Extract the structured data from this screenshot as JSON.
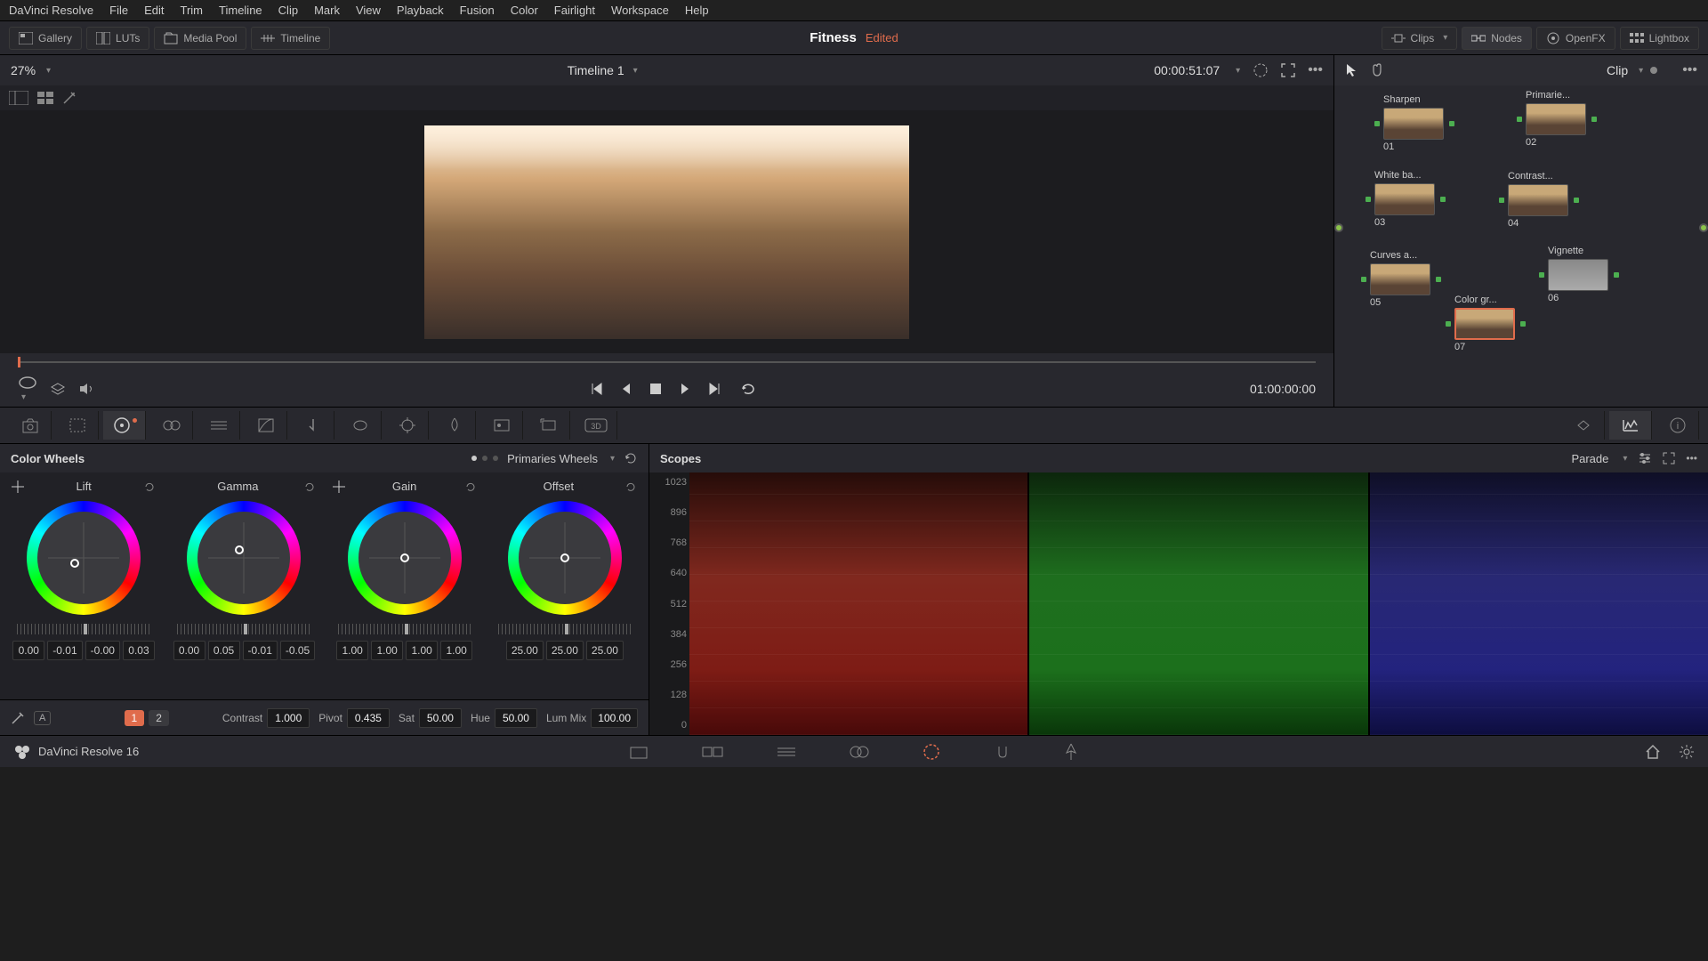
{
  "menu": [
    "DaVinci Resolve",
    "File",
    "Edit",
    "Trim",
    "Timeline",
    "Clip",
    "Mark",
    "View",
    "Playback",
    "Fusion",
    "Color",
    "Fairlight",
    "Workspace",
    "Help"
  ],
  "topbar": {
    "gallery": "Gallery",
    "luts": "LUTs",
    "media_pool": "Media Pool",
    "timeline": "Timeline",
    "clips": "Clips",
    "nodes": "Nodes",
    "openfx": "OpenFX",
    "lightbox": "Lightbox"
  },
  "project": {
    "name": "Fitness",
    "status": "Edited"
  },
  "viewer": {
    "zoom": "27%",
    "timeline_name": "Timeline 1",
    "timecode_in": "00:00:51:07",
    "timecode_out": "01:00:00:00"
  },
  "node_panel": {
    "mode": "Clip",
    "nodes": [
      {
        "label": "Sharpen",
        "num": "01"
      },
      {
        "label": "Primarie...",
        "num": "02"
      },
      {
        "label": "White ba...",
        "num": "03"
      },
      {
        "label": "Contrast...",
        "num": "04"
      },
      {
        "label": "Curves a...",
        "num": "05"
      },
      {
        "label": "Vignette",
        "num": "06"
      },
      {
        "label": "Color gr...",
        "num": "07"
      }
    ]
  },
  "wheels": {
    "title": "Color Wheels",
    "mode": "Primaries Wheels",
    "groups": [
      {
        "name": "Lift",
        "values": [
          "0.00",
          "-0.01",
          "-0.00",
          "0.03"
        ]
      },
      {
        "name": "Gamma",
        "values": [
          "0.00",
          "0.05",
          "-0.01",
          "-0.05"
        ]
      },
      {
        "name": "Gain",
        "values": [
          "1.00",
          "1.00",
          "1.00",
          "1.00"
        ]
      },
      {
        "name": "Offset",
        "values": [
          "25.00",
          "25.00",
          "25.00"
        ]
      }
    ],
    "pages": [
      "1",
      "2"
    ]
  },
  "adjustments": {
    "contrast_label": "Contrast",
    "contrast": "1.000",
    "pivot_label": "Pivot",
    "pivot": "0.435",
    "sat_label": "Sat",
    "sat": "50.00",
    "hue_label": "Hue",
    "hue": "50.00",
    "lummix_label": "Lum Mix",
    "lummix": "100.00"
  },
  "scopes": {
    "title": "Scopes",
    "mode": "Parade",
    "scale": [
      "1023",
      "896",
      "768",
      "640",
      "512",
      "384",
      "256",
      "128",
      "0"
    ]
  },
  "footer": {
    "app": "DaVinci Resolve 16"
  }
}
